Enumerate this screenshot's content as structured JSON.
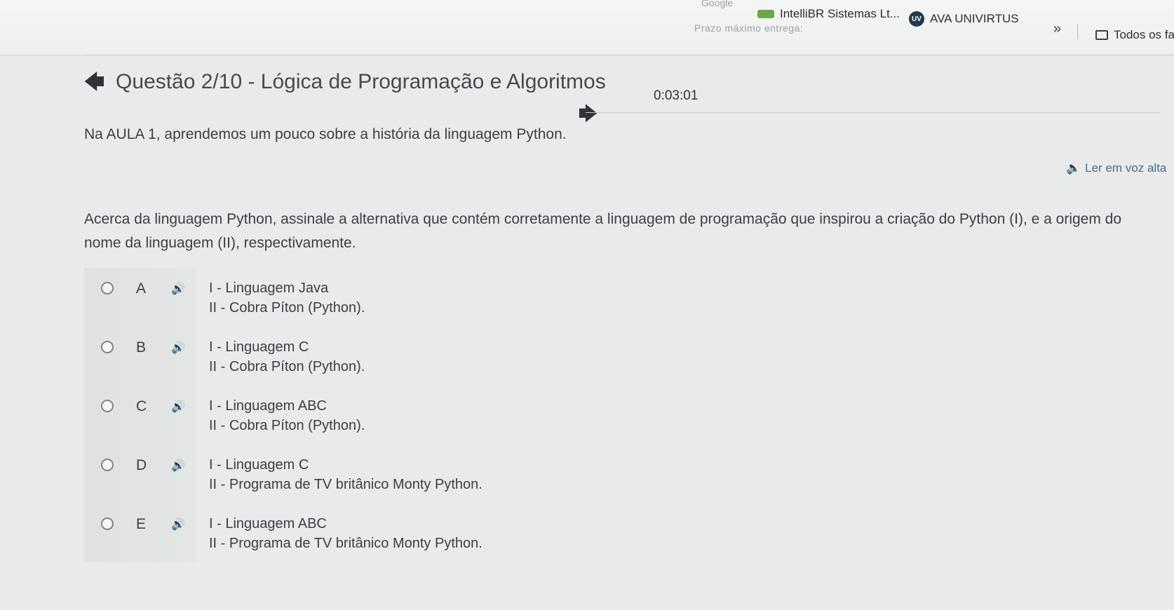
{
  "bookmarks": {
    "faded_google": "Google",
    "faded_deadline": "Prazo máximo entrega:",
    "items": [
      {
        "label": "IntelliBR Sistemas Lt..."
      },
      {
        "label": "AVA UNIVIRTUS"
      }
    ],
    "more": "»",
    "all_favorites": "Todos os favo"
  },
  "header": {
    "title": "Questão 2/10 - Lógica de Programação e Algoritmos",
    "timer": "0:03:01"
  },
  "statement": {
    "intro": "Na AULA 1, aprendemos um pouco sobre a história da linguagem Python.",
    "read_aloud": "Ler em voz alta",
    "question": "Acerca da linguagem Python, assinale a alternativa que contém corretamente a linguagem de programação que inspirou a criação do Python (I), e a origem do nome da linguagem (II), respectivamente."
  },
  "options": [
    {
      "letter": "A",
      "line1": "I - Linguagem Java",
      "line2": "II - Cobra Píton (Python)."
    },
    {
      "letter": "B",
      "line1": "I - Linguagem C",
      "line2": "II - Cobra Píton (Python)."
    },
    {
      "letter": "C",
      "line1": "I - Linguagem ABC",
      "line2": "II - Cobra Píton (Python)."
    },
    {
      "letter": "D",
      "line1": "I - Linguagem C",
      "line2": "II - Programa de TV britânico Monty Python."
    },
    {
      "letter": "E",
      "line1": "I - Linguagem ABC",
      "line2": "II - Programa de TV britânico Monty Python."
    }
  ]
}
